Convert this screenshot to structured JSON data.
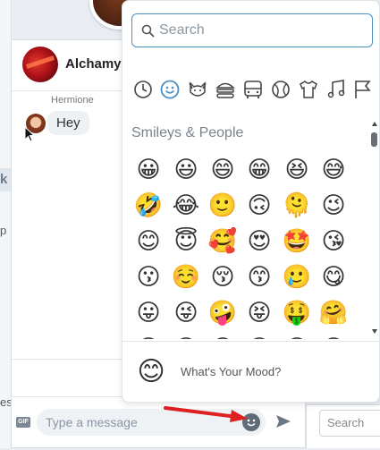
{
  "chat": {
    "title": "Alchamy",
    "message": {
      "sender": "Hermione",
      "text": "Hey"
    },
    "composer": {
      "placeholder": "Type a message",
      "gif_label": "GIF"
    }
  },
  "right_panel": {
    "search_placeholder": "Search"
  },
  "background": {
    "tag_letter": "k",
    "fragment_p": "p",
    "fragment_es": "es"
  },
  "picker": {
    "search_placeholder": "Search",
    "categories": [
      {
        "icon": "recent-clock-icon"
      },
      {
        "icon": "smiley-icon",
        "active": true
      },
      {
        "icon": "cat-icon"
      },
      {
        "icon": "burger-icon"
      },
      {
        "icon": "bus-icon"
      },
      {
        "icon": "ball-icon"
      },
      {
        "icon": "shirt-icon"
      },
      {
        "icon": "music-icon"
      },
      {
        "icon": "flag-icon"
      }
    ],
    "section_title": "Smileys & People",
    "emojis": [
      [
        "😀",
        "😃",
        "😄",
        "😁",
        "😆",
        "😅"
      ],
      [
        "🤣",
        "😂",
        "🙂",
        "🙃",
        "🫠",
        "😉"
      ],
      [
        "😊",
        "😇",
        "🥰",
        "😍",
        "🤩",
        "😘"
      ],
      [
        "😗",
        "☺️",
        "😚",
        "😙",
        "🥲",
        "😋"
      ],
      [
        "😛",
        "😜",
        "🤪",
        "😝",
        "🤑",
        "🤗"
      ],
      [
        "😀",
        "😀",
        "😀",
        "😀",
        "😀",
        "😀"
      ]
    ],
    "mood": {
      "emoji": "😊",
      "text": "What's Your Mood?"
    }
  },
  "colors": {
    "accent": "#4a90c2",
    "annotation_arrow": "#e02020"
  }
}
